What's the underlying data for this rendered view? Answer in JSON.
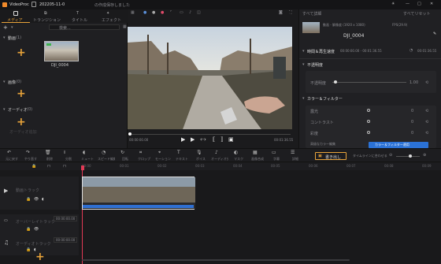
{
  "titlebar": {
    "app": "VideoProc",
    "project": "202205-11-0",
    "status": "の作成保存しました",
    "menu_icons": [
      "sun-icon",
      "minimize-icon",
      "maximize-icon",
      "close-icon"
    ]
  },
  "left": {
    "tabs": [
      {
        "label": "メディア"
      },
      {
        "label": "トランジション"
      },
      {
        "label": "タイトル"
      },
      {
        "label": "エフェクト"
      }
    ],
    "search_placeholder": "検索...",
    "sections": [
      {
        "title": "動画",
        "count": "(1)",
        "plus": "+"
      },
      {
        "title": "画像",
        "count": "(0)",
        "plus": "+"
      },
      {
        "title": "オーディオ",
        "count": "(0)",
        "plus": "+",
        "hint": "オーディオ追加"
      }
    ],
    "clip": {
      "name": "DJI_0004"
    }
  },
  "preview": {
    "time_current": "00:00:00.00",
    "time_total": "00:01:36.55",
    "progress": 0.0
  },
  "right": {
    "export_label": "すべて詳細",
    "export2": "すべてリセット",
    "info": {
      "name": "DJI_0004",
      "line1": "動画 - 解像度 (1920 x 1080)",
      "line2": "FPS(29.9)"
    },
    "sections": [
      {
        "title": "時間＆再生速度",
        "value1": "00:00:00.00 - 00:01:36.55",
        "value2": "00:01:36.55"
      },
      {
        "title": "不透明度"
      },
      {
        "title": "カラー＆フィルター"
      }
    ],
    "opacity": {
      "label": "不透明度",
      "value": "1.00"
    },
    "color_rows": [
      {
        "label": "露光",
        "value": "0"
      },
      {
        "label": "コントラスト",
        "value": "0"
      },
      {
        "label": "彩度",
        "value": "0"
      }
    ],
    "apply_label": "カラー＆フィルター適用",
    "color_edit_label": "高級なカラー編集"
  },
  "toolbar": {
    "items": [
      "元に戻す",
      "やり直す",
      "削除",
      "分割",
      "ミュート",
      "スピード編集",
      "回転",
      "クロップ",
      "モーション",
      "テキスト",
      "ボイス",
      "オーディオ分離",
      "マスク",
      "画像合成",
      "字幕",
      "詳細"
    ],
    "export_label": "書き出し",
    "zoom_label": "タイムラインに合わせる"
  },
  "timeline": {
    "tracks": [
      {
        "name": "動画トラック"
      },
      {
        "name": "オーバーレイトラック"
      },
      {
        "name": "オーディオトラック"
      }
    ],
    "badge1": "00:00:00.00",
    "badge2": "00:00:00.00",
    "times": [
      "00:00",
      "00:01",
      "00:02",
      "00:03",
      "00:04",
      "00:05",
      "00:06",
      "00:07",
      "00:08",
      "00:09"
    ]
  }
}
